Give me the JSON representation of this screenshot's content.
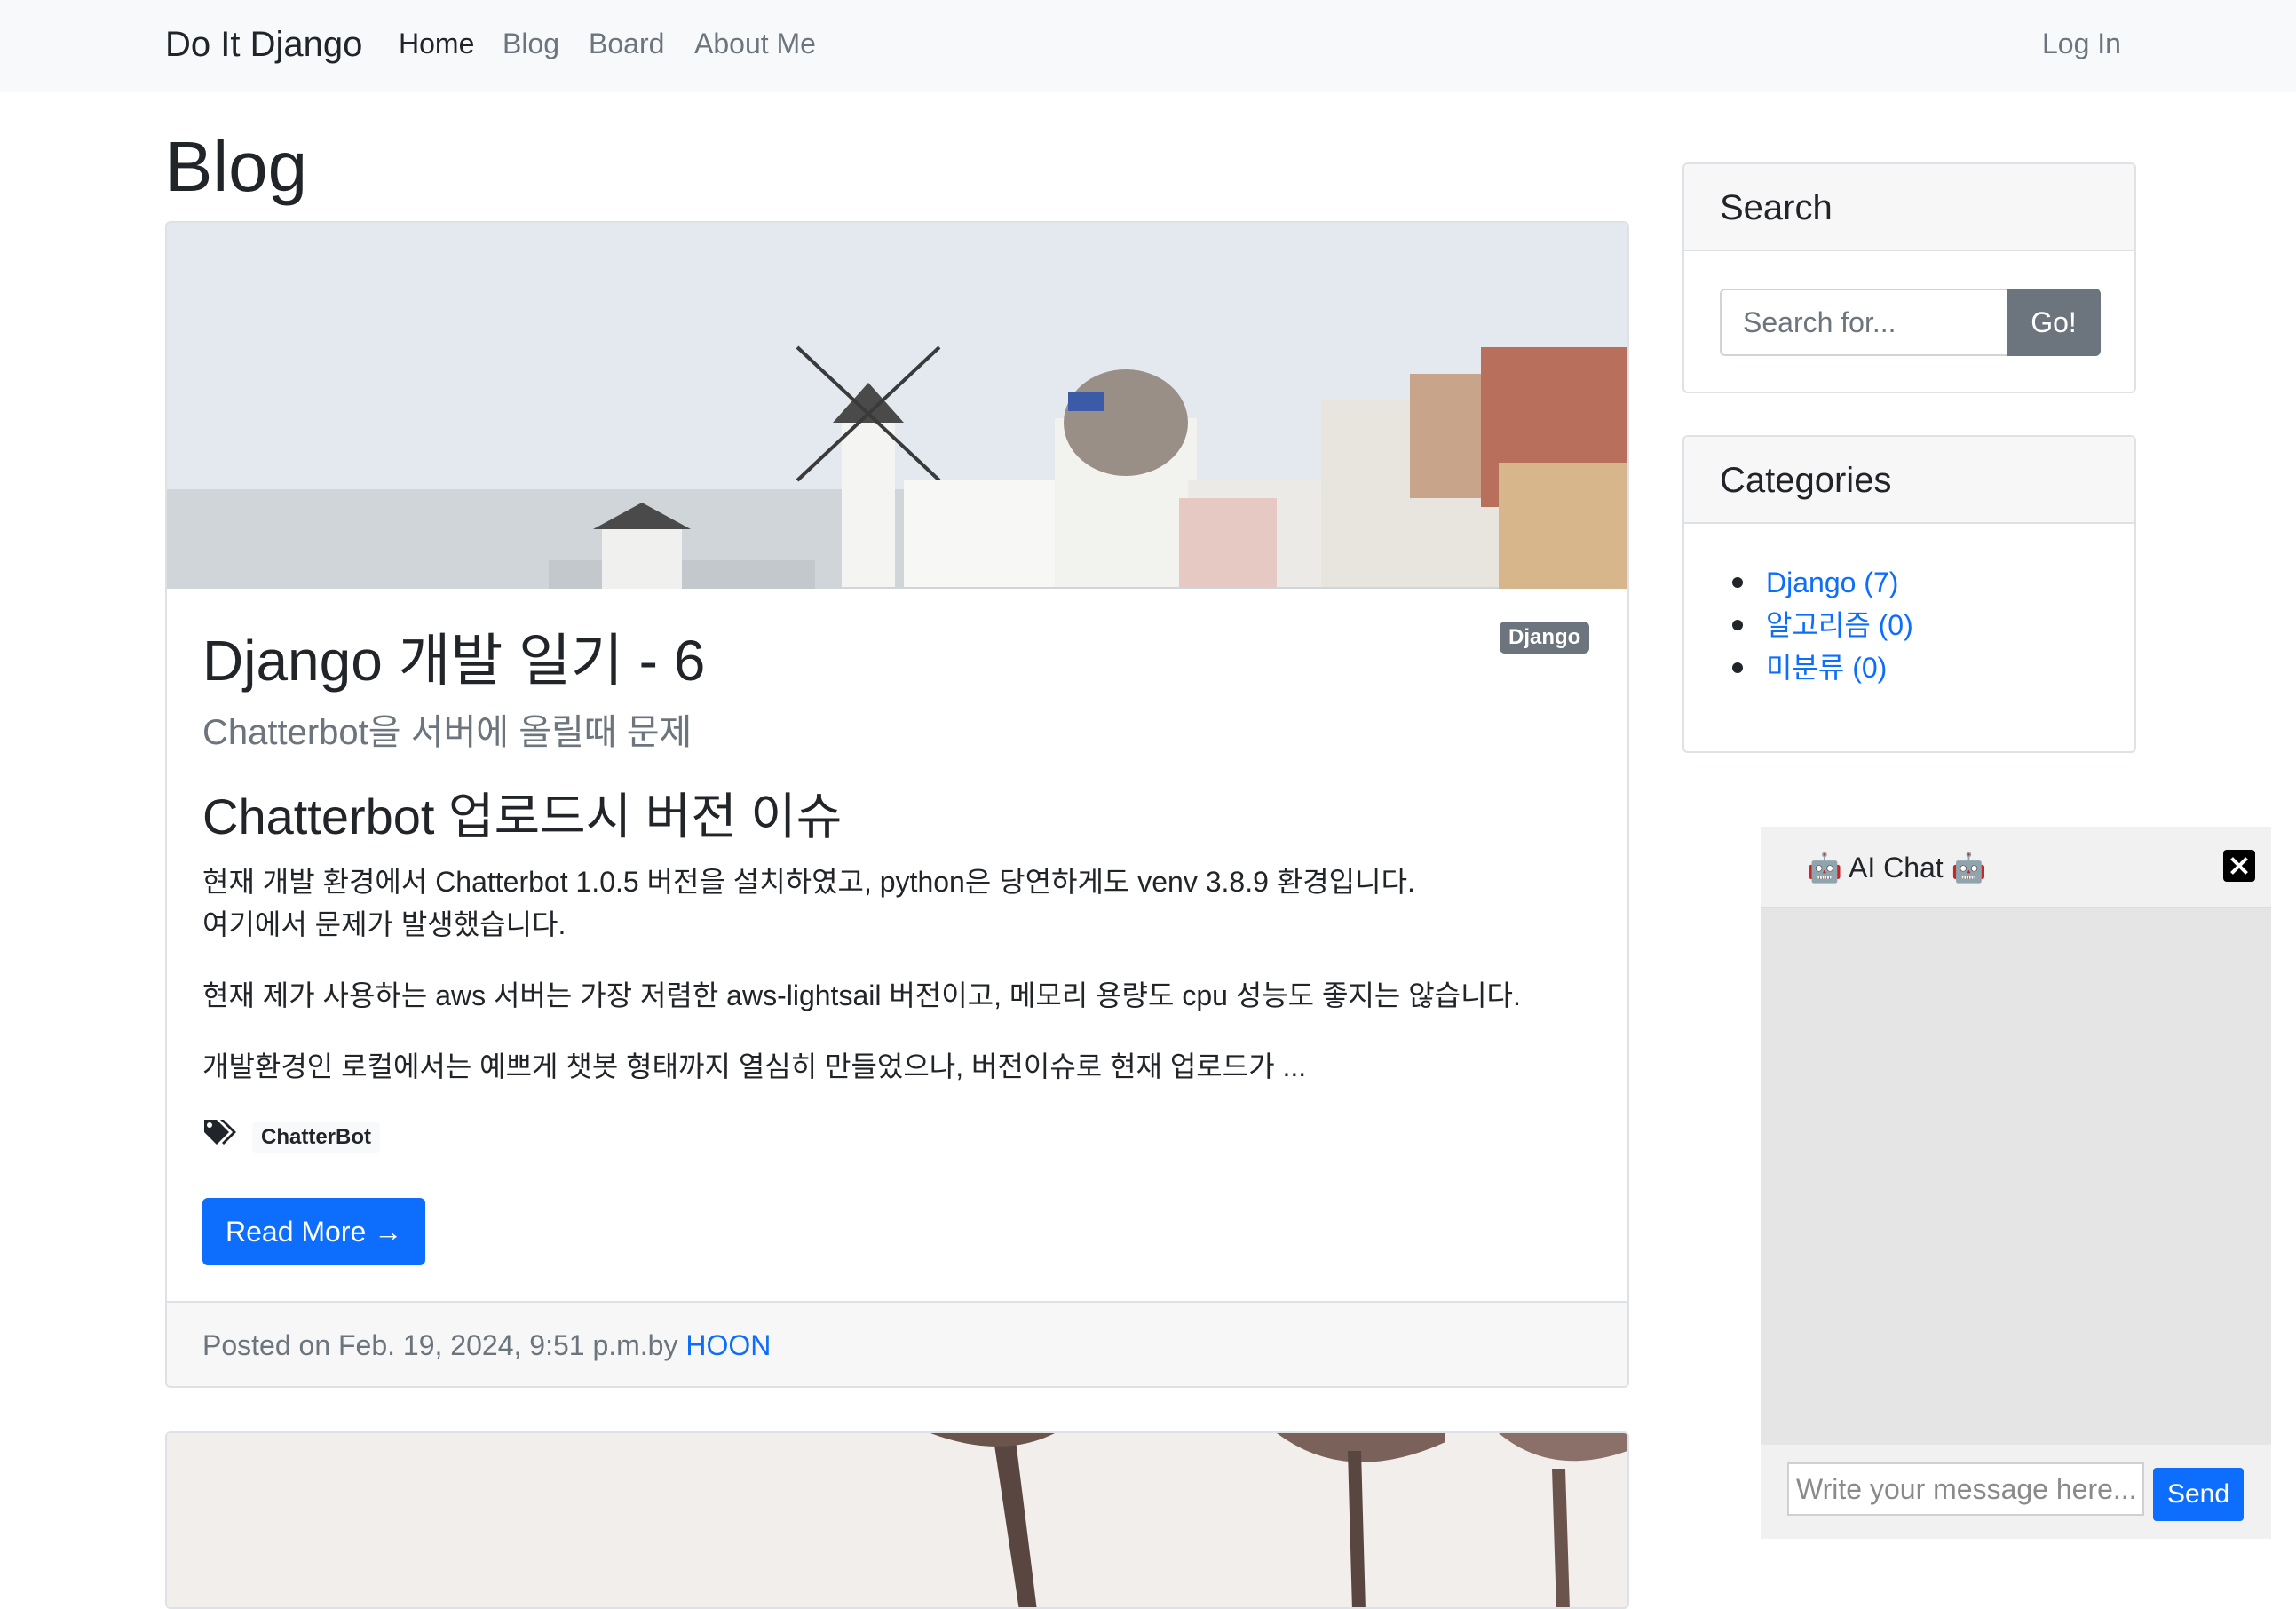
{
  "navbar": {
    "brand": "Do It Django",
    "links": [
      "Home",
      "Blog",
      "Board",
      "About Me"
    ],
    "login": "Log In"
  },
  "page": {
    "title": "Blog"
  },
  "post": {
    "category_badge": "Django",
    "title": "Django 개발 일기 - 6",
    "subtitle": "Chatterbot을 서버에 올릴때 문제",
    "heading": "Chatterbot 업로드시 버전 이슈",
    "para1_line1": "현재 개발 환경에서 Chatterbot 1.0.5 버전을 설치하였고, python은 당연하게도 venv 3.8.9 환경입니다.",
    "para1_line2": "여기에서 문제가 발생했습니다.",
    "para2": "현재 제가 사용하는 aws 서버는 가장 저렴한 aws-lightsail 버전이고, 메모리 용량도 cpu 성능도 좋지는 않습니다.",
    "para3": "개발환경인 로컬에서는 예쁘게 챗봇 형태까지 열심히 만들었으나, 버전이슈로 현재 업로드가 ...",
    "tag": "ChatterBot",
    "read_more": "Read More →",
    "footer_prefix": "Posted on Feb. 19, 2024, 9:51 p.m.by ",
    "author": "HOON"
  },
  "sidebar": {
    "search": {
      "title": "Search",
      "placeholder": "Search for...",
      "button": "Go!"
    },
    "categories": {
      "title": "Categories",
      "items": [
        "Django (7)",
        "알고리즘 (0)",
        "미분류 (0)"
      ]
    }
  },
  "chat": {
    "title": "🤖 AI Chat 🤖",
    "placeholder": "Write your message here...",
    "send": "Send"
  },
  "colors": {
    "primary": "#0d6efd",
    "secondary": "#6c757d",
    "navbar_bg": "#f8f9fa"
  }
}
